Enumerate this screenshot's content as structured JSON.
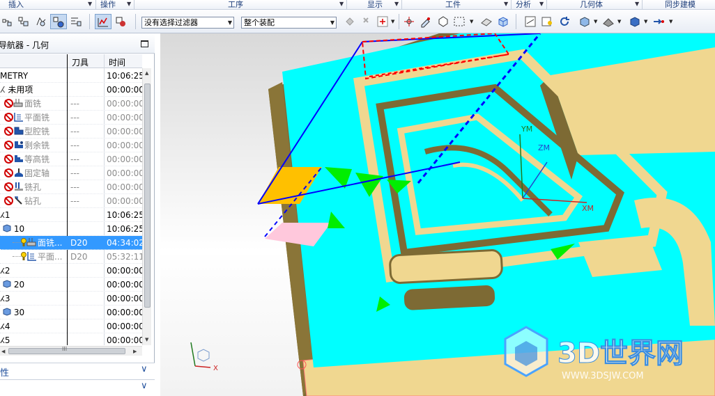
{
  "ribbon": {
    "groups": [
      "插入",
      "操作",
      "工序",
      "显示",
      "工件",
      "分析",
      "几何体",
      "同步建模"
    ]
  },
  "toolbar": {
    "filter_value": "没有选择过滤器",
    "assembly_value": "整个装配"
  },
  "navigator": {
    "title": "导航器 - 几何",
    "columns": [
      "刀具",
      "时间"
    ],
    "rows": [
      {
        "name": "METRY",
        "tool": "",
        "time": "10:06:25",
        "icon": "none",
        "state": "normal"
      },
      {
        "name": "未用项",
        "tool": "",
        "time": "00:00:00",
        "icon": "folder",
        "state": "normal"
      },
      {
        "name": "面铣",
        "tool": "---",
        "time": "00:00:00",
        "icon": "face-mill",
        "state": "gray"
      },
      {
        "name": "平面铣",
        "tool": "---",
        "time": "00:00:00",
        "icon": "planar-mill",
        "state": "gray"
      },
      {
        "name": "型腔铣",
        "tool": "---",
        "time": "00:00:00",
        "icon": "cavity-mill",
        "state": "gray"
      },
      {
        "name": "剩余铣",
        "tool": "---",
        "time": "00:00:00",
        "icon": "rest-mill",
        "state": "gray"
      },
      {
        "name": "等高铣",
        "tool": "---",
        "time": "00:00:00",
        "icon": "zlevel-mill",
        "state": "gray"
      },
      {
        "name": "固定轴",
        "tool": "---",
        "time": "00:00:00",
        "icon": "fixed-axis",
        "state": "gray"
      },
      {
        "name": "铣孔",
        "tool": "---",
        "time": "00:00:00",
        "icon": "hole-mill",
        "state": "gray"
      },
      {
        "name": "钻孔",
        "tool": "---",
        "time": "00:00:00",
        "icon": "drill",
        "state": "gray"
      },
      {
        "name": "1",
        "tool": "",
        "time": "10:06:25",
        "icon": "mcs",
        "state": "normal"
      },
      {
        "name": "10",
        "tool": "",
        "time": "10:06:25",
        "icon": "workpiece",
        "state": "normal"
      },
      {
        "name": "面铣...",
        "tool": "D20",
        "time": "04:34:02",
        "icon": "face-mill",
        "state": "selected"
      },
      {
        "name": "平面...",
        "tool": "D20",
        "time": "05:32:11",
        "icon": "planar-mill",
        "state": "gray"
      },
      {
        "name": "2",
        "tool": "",
        "time": "00:00:00",
        "icon": "mcs",
        "state": "normal"
      },
      {
        "name": "20",
        "tool": "",
        "time": "00:00:00",
        "icon": "workpiece",
        "state": "normal"
      },
      {
        "name": "3",
        "tool": "",
        "time": "00:00:00",
        "icon": "mcs",
        "state": "normal"
      },
      {
        "name": "30",
        "tool": "",
        "time": "00:00:00",
        "icon": "workpiece",
        "state": "normal"
      },
      {
        "name": "4",
        "tool": "",
        "time": "00:00:00",
        "icon": "mcs",
        "state": "normal"
      },
      {
        "name": "5",
        "tool": "",
        "time": "00:00:00",
        "icon": "mcs",
        "state": "normal"
      }
    ],
    "scroll_label": "III"
  },
  "panels": {
    "properties_label": "性",
    "collapsed_chevron": "∨"
  },
  "viewport": {
    "wcs_labels": {
      "x": "XM",
      "y": "YM",
      "z": "ZM"
    },
    "view_triad_x": "X",
    "watermark_main": "3D世界网",
    "watermark_sub": "WWW.3DSJW.COM"
  },
  "colors": {
    "surface": "#00ffff",
    "wall": "#f0d790",
    "wall_dark": "#7d6a34",
    "toolpath_blue": "#0000ff",
    "toolpath_red": "#ff0000",
    "selection": "#3399ff"
  }
}
